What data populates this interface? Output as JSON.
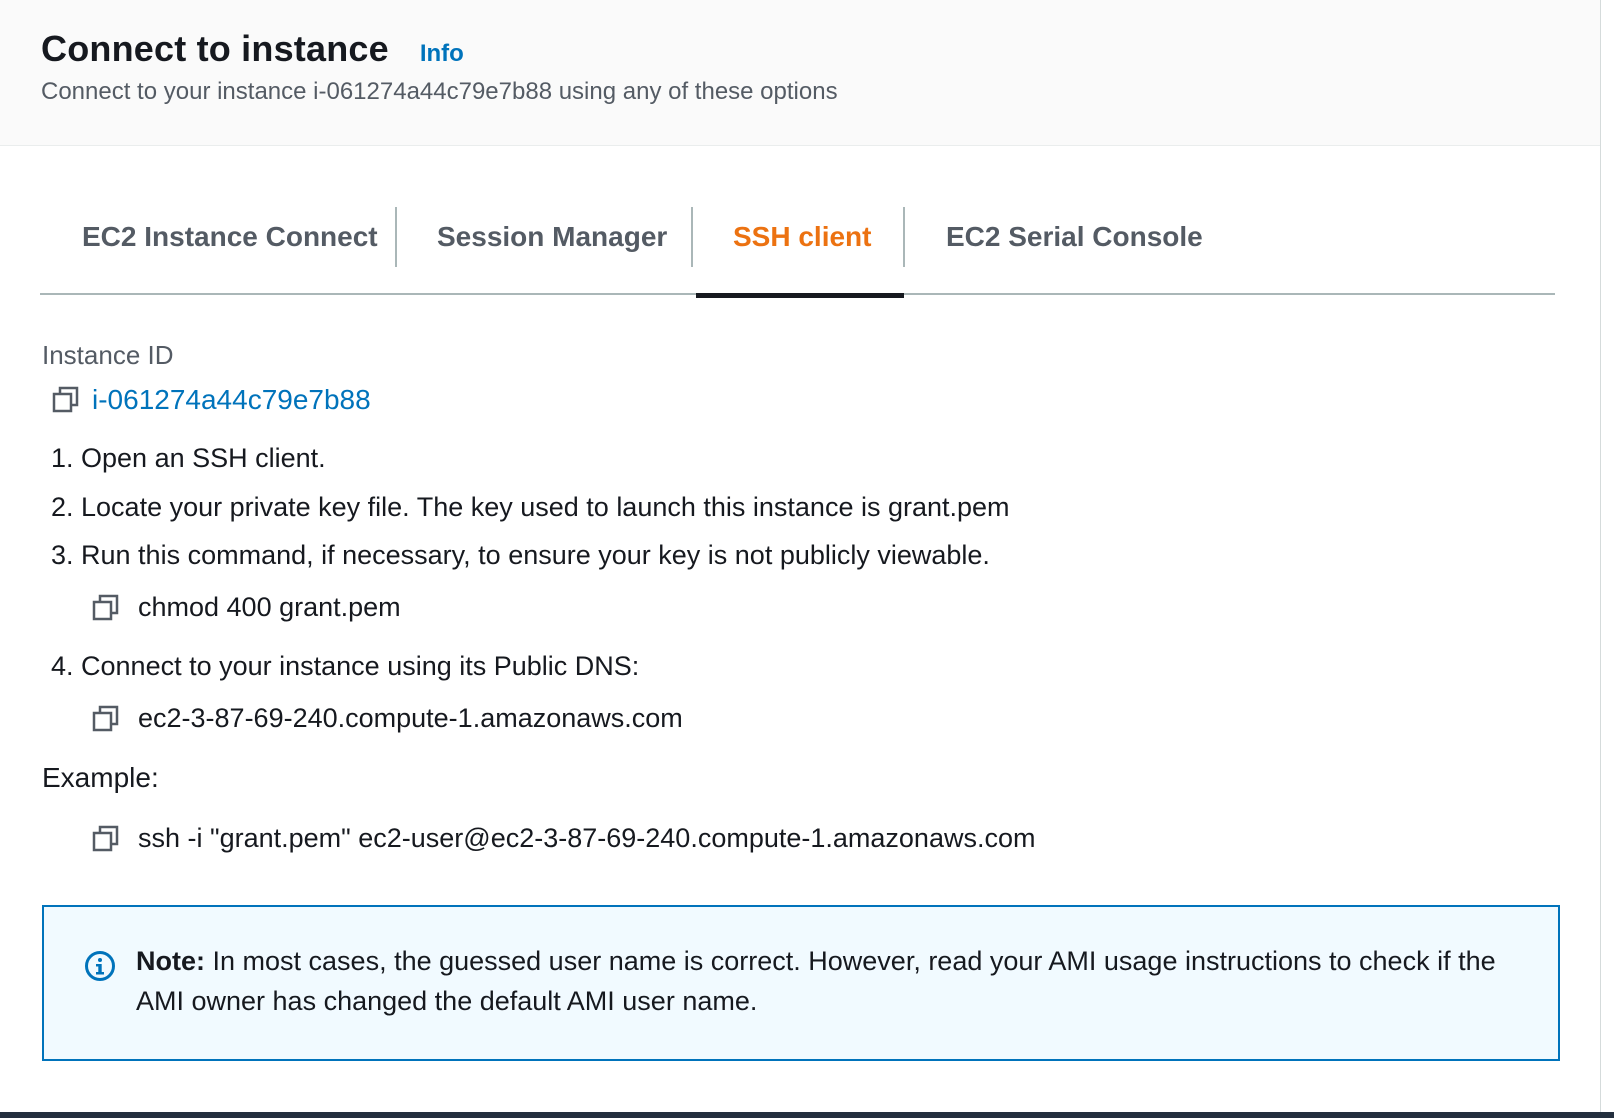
{
  "header": {
    "title": "Connect to instance",
    "info_label": "Info",
    "subtitle": "Connect to your instance i-061274a44c79e7b88 using any of these options"
  },
  "tabs": [
    {
      "label": "EC2 Instance Connect",
      "active": false
    },
    {
      "label": "Session Manager",
      "active": false
    },
    {
      "label": "SSH client",
      "active": true
    },
    {
      "label": "EC2 Serial Console",
      "active": false
    }
  ],
  "instance": {
    "label": "Instance ID",
    "id": "i-061274a44c79e7b88"
  },
  "steps": [
    {
      "text": "1. Open an SSH client."
    },
    {
      "text": "2. Locate your private key file. The key used to launch this instance is grant.pem"
    },
    {
      "text": "3. Run this command, if necessary, to ensure your key is not publicly viewable."
    },
    {
      "text": "4. Connect to your instance using its Public DNS:"
    }
  ],
  "commands": {
    "chmod": "chmod 400 grant.pem",
    "public_dns": "ec2-3-87-69-240.compute-1.amazonaws.com",
    "example_label": "Example:",
    "example_ssh": "ssh -i \"grant.pem\" ec2-user@ec2-3-87-69-240.compute-1.amazonaws.com"
  },
  "note": {
    "strong": "Note:",
    "text": " In most cases, the guessed user name is correct. However, read your AMI usage instructions to check if the AMI owner has changed the default AMI user name."
  },
  "icons": {
    "copy": "copy-icon",
    "info": "info-circle-icon"
  },
  "colors": {
    "active_tab": "#ec7211",
    "link": "#0073bb",
    "note_border": "#0073bb",
    "note_background": "#f1faff"
  }
}
